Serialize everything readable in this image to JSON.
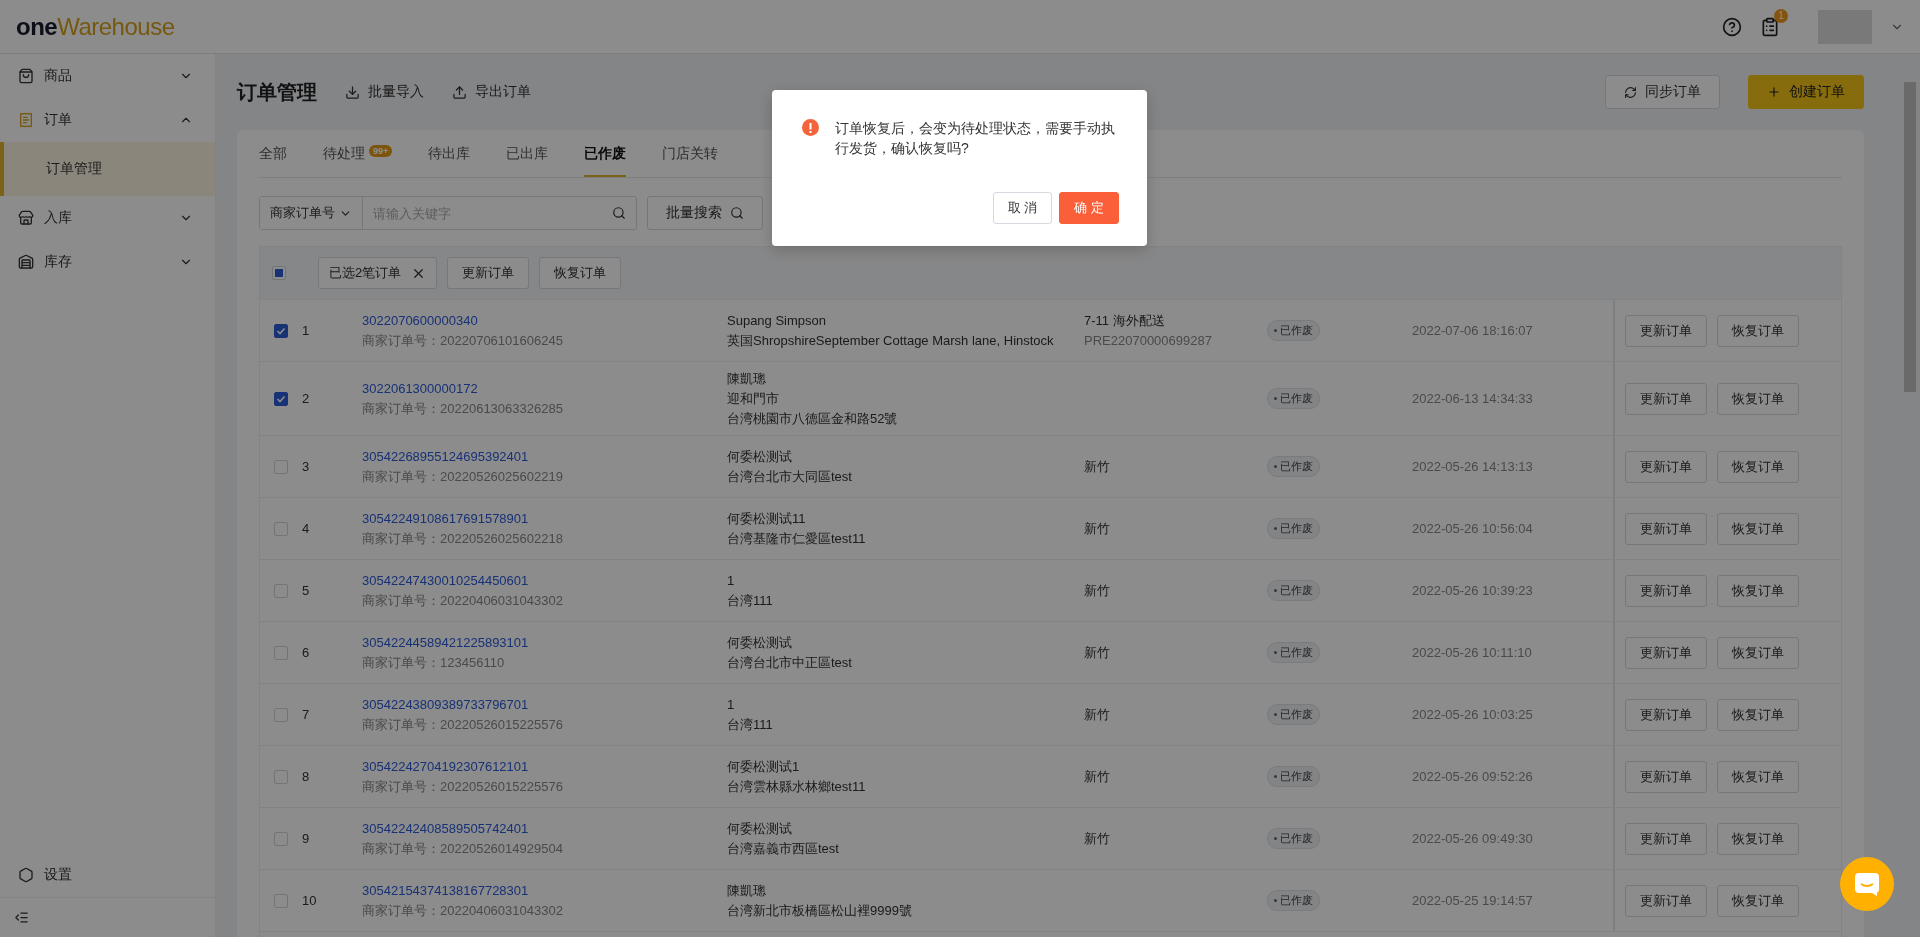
{
  "header": {
    "logo_one": "one",
    "logo_rest": "Warehouse",
    "notification_count": "1"
  },
  "sidebar": {
    "items": [
      {
        "label": "商品",
        "expanded": false
      },
      {
        "label": "订单",
        "expanded": true,
        "children": [
          {
            "label": "订单管理",
            "selected": true
          }
        ]
      },
      {
        "label": "入库",
        "expanded": false
      },
      {
        "label": "库存",
        "expanded": false
      }
    ],
    "settings": "设置"
  },
  "page": {
    "title": "订单管理",
    "actions": [
      {
        "label": "批量导入"
      },
      {
        "label": "导出订单"
      }
    ],
    "buttons": [
      {
        "label": "同步订单",
        "kind": "default"
      },
      {
        "label": "创建订单",
        "kind": "primary"
      }
    ]
  },
  "tabs": [
    {
      "label": "全部",
      "selected": false
    },
    {
      "label": "待处理",
      "badge": "99+",
      "selected": false
    },
    {
      "label": "待出库",
      "selected": false
    },
    {
      "label": "已出库",
      "selected": false
    },
    {
      "label": "已作废",
      "selected": true
    },
    {
      "label": "门店关转",
      "selected": false
    }
  ],
  "filter": {
    "field": "商家订单号",
    "placeholder": "请输入关键字",
    "batch_search": "批量搜索"
  },
  "selection_bar": {
    "indeterminate": true,
    "chip": "已选2笔订单",
    "buttons": [
      "更新订单",
      "恢复订单"
    ]
  },
  "rows": [
    {
      "index": "1",
      "selected": true,
      "order_no": "3022070600000340",
      "merchant_no": "商家订单号：20220706101606245",
      "recipient": [
        "Supang Simpson",
        "英国ShropshireSeptember Cottage Marsh lane, Hinstock"
      ],
      "shipping": [
        "7-11 海外配送",
        "PRE22070000699287"
      ],
      "status": "已作废",
      "time": "2022-07-06 18:16:07",
      "actions": [
        "更新订单",
        "恢复订单"
      ]
    },
    {
      "index": "2",
      "selected": true,
      "order_no": "3022061300000172",
      "merchant_no": "商家订单号：20220613063326285",
      "recipient": [
        "陳凱璁",
        "迎和門市",
        "台湾桃園市八德區金和路52號"
      ],
      "status": "已作废",
      "time": "2022-06-13 14:34:33",
      "actions": [
        "更新订单",
        "恢复订单"
      ]
    },
    {
      "index": "3",
      "selected": false,
      "order_no": "30542268955124695392401",
      "merchant_no": "商家订单号：20220526025602219",
      "recipient": [
        "何委松测试",
        "台湾台北市大同區test"
      ],
      "shipping": [
        "新竹"
      ],
      "status": "已作废",
      "time": "2022-05-26 14:13:13",
      "actions": [
        "更新订单",
        "恢复订单"
      ]
    },
    {
      "index": "4",
      "selected": false,
      "order_no": "30542249108617691578901",
      "merchant_no": "商家订单号：20220526025602218",
      "recipient": [
        "何委松测试11",
        "台湾基隆市仁愛區test11"
      ],
      "shipping": [
        "新竹"
      ],
      "status": "已作废",
      "time": "2022-05-26 10:56:04",
      "actions": [
        "更新订单",
        "恢复订单"
      ]
    },
    {
      "index": "5",
      "selected": false,
      "order_no": "30542247430010254450601",
      "merchant_no": "商家订单号：20220406031043302",
      "recipient": [
        "1",
        "台湾111"
      ],
      "shipping": [
        "新竹"
      ],
      "status": "已作废",
      "time": "2022-05-26 10:39:23",
      "actions": [
        "更新订单",
        "恢复订单"
      ]
    },
    {
      "index": "6",
      "selected": false,
      "order_no": "30542244589421225893101",
      "merchant_no": "商家订单号：123456110",
      "recipient": [
        "何委松测试",
        "台湾台北市中正區test"
      ],
      "shipping": [
        "新竹"
      ],
      "status": "已作废",
      "time": "2022-05-26 10:11:10",
      "actions": [
        "更新订单",
        "恢复订单"
      ]
    },
    {
      "index": "7",
      "selected": false,
      "order_no": "30542243809389733796701",
      "merchant_no": "商家订单号：20220526015225576",
      "recipient": [
        "1",
        "台湾111"
      ],
      "shipping": [
        "新竹"
      ],
      "status": "已作废",
      "time": "2022-05-26 10:03:25",
      "actions": [
        "更新订单",
        "恢复订单"
      ]
    },
    {
      "index": "8",
      "selected": false,
      "order_no": "30542242704192307612101",
      "merchant_no": "商家订单号：20220526015225576",
      "recipient": [
        "何委松测试1",
        "台湾雲林縣水林鄉test11"
      ],
      "shipping": [
        "新竹"
      ],
      "status": "已作废",
      "time": "2022-05-26 09:52:26",
      "actions": [
        "更新订单",
        "恢复订单"
      ]
    },
    {
      "index": "9",
      "selected": false,
      "order_no": "30542242408589505742401",
      "merchant_no": "商家订单号：20220526014929504",
      "recipient": [
        "何委松测试",
        "台湾嘉義市西區test"
      ],
      "shipping": [
        "新竹"
      ],
      "status": "已作废",
      "time": "2022-05-26 09:49:30",
      "actions": [
        "更新订单",
        "恢复订单"
      ]
    },
    {
      "index": "10",
      "selected": false,
      "order_no": "30542154374138167728301",
      "merchant_no": "商家订单号：20220406031043302",
      "recipient": [
        "陳凱璁",
        "台湾新北市板橋區松山裡9999號"
      ],
      "status": "已作废",
      "time": "2022-05-25 19:14:57",
      "actions": [
        "更新订单",
        "恢复订单"
      ]
    }
  ],
  "dialog": {
    "message": "订单恢复后，会变为待处理状态，需要手动执行发货，确认恢复吗?",
    "buttons": [
      {
        "label": "取 消",
        "kind": "default"
      },
      {
        "label": "确 定",
        "kind": "primary"
      }
    ]
  }
}
